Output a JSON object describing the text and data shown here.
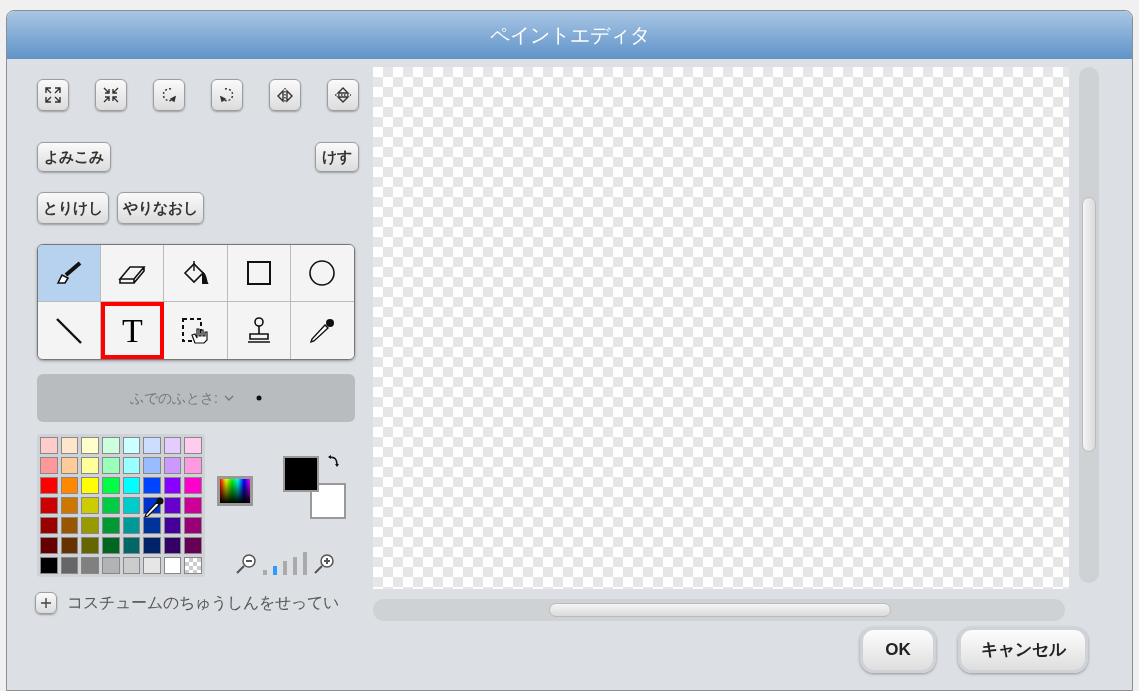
{
  "window": {
    "title": "ペイントエディタ"
  },
  "transform_buttons": [
    {
      "kind": "grow"
    },
    {
      "kind": "shrink"
    },
    {
      "kind": "rotate-left"
    },
    {
      "kind": "rotate-right"
    },
    {
      "kind": "flip-horizontal"
    },
    {
      "kind": "flip-vertical"
    }
  ],
  "file_buttons": [
    {
      "label": "よみこみ"
    },
    {
      "label": "けす"
    }
  ],
  "edit_buttons": [
    {
      "label": "とりけし"
    },
    {
      "label": "やりなおし"
    }
  ],
  "tools": [
    {
      "kind": "brush",
      "selected": true,
      "highlighted": false
    },
    {
      "kind": "eraser",
      "selected": false,
      "highlighted": false
    },
    {
      "kind": "fill",
      "selected": false,
      "highlighted": false
    },
    {
      "kind": "rectangle",
      "selected": false,
      "highlighted": false
    },
    {
      "kind": "ellipse",
      "selected": false,
      "highlighted": false
    },
    {
      "kind": "line",
      "selected": false,
      "highlighted": false
    },
    {
      "kind": "text",
      "label": "T",
      "selected": false,
      "highlighted": true
    },
    {
      "kind": "select",
      "selected": false,
      "highlighted": false
    },
    {
      "kind": "stamp",
      "selected": false,
      "highlighted": false
    },
    {
      "kind": "eyedropper",
      "selected": false,
      "highlighted": false
    }
  ],
  "brush_size": {
    "label": "ふでのふとさ:",
    "disabled": true
  },
  "palette": [
    {
      "kind": "solid",
      "color": "#ffcccc"
    },
    {
      "kind": "solid",
      "color": "#ffe5cc"
    },
    {
      "kind": "solid",
      "color": "#ffffcc"
    },
    {
      "kind": "solid",
      "color": "#ccffdd"
    },
    {
      "kind": "solid",
      "color": "#ccffff"
    },
    {
      "kind": "solid",
      "color": "#ccddff"
    },
    {
      "kind": "solid",
      "color": "#e5ccff"
    },
    {
      "kind": "solid",
      "color": "#ffccf0"
    },
    {
      "kind": "solid",
      "color": "#ff9999"
    },
    {
      "kind": "solid",
      "color": "#ffcc99"
    },
    {
      "kind": "solid",
      "color": "#ffff99"
    },
    {
      "kind": "solid",
      "color": "#99ffbb"
    },
    {
      "kind": "solid",
      "color": "#99ffff"
    },
    {
      "kind": "solid",
      "color": "#99bbff"
    },
    {
      "kind": "solid",
      "color": "#cc99ff"
    },
    {
      "kind": "solid",
      "color": "#ff99e0"
    },
    {
      "kind": "solid",
      "color": "#ff0000"
    },
    {
      "kind": "solid",
      "color": "#ff8800"
    },
    {
      "kind": "solid",
      "color": "#ffff00"
    },
    {
      "kind": "solid",
      "color": "#00ff44"
    },
    {
      "kind": "solid",
      "color": "#00ffff"
    },
    {
      "kind": "solid",
      "color": "#0044ff"
    },
    {
      "kind": "solid",
      "color": "#8800ff"
    },
    {
      "kind": "solid",
      "color": "#ff00cc"
    },
    {
      "kind": "solid",
      "color": "#cc0000"
    },
    {
      "kind": "solid",
      "color": "#cc7700"
    },
    {
      "kind": "solid",
      "color": "#cccc00"
    },
    {
      "kind": "solid",
      "color": "#00cc44"
    },
    {
      "kind": "solid",
      "color": "#00cccc"
    },
    {
      "kind": "solid",
      "color": "#0033cc"
    },
    {
      "kind": "solid",
      "color": "#6600cc"
    },
    {
      "kind": "solid",
      "color": "#cc0099"
    },
    {
      "kind": "solid",
      "color": "#990000"
    },
    {
      "kind": "solid",
      "color": "#995500"
    },
    {
      "kind": "solid",
      "color": "#999900"
    },
    {
      "kind": "solid",
      "color": "#009933"
    },
    {
      "kind": "solid",
      "color": "#009999"
    },
    {
      "kind": "solid",
      "color": "#003399"
    },
    {
      "kind": "solid",
      "color": "#440099"
    },
    {
      "kind": "solid",
      "color": "#990077"
    },
    {
      "kind": "solid",
      "color": "#660000"
    },
    {
      "kind": "solid",
      "color": "#663300"
    },
    {
      "kind": "solid",
      "color": "#666600"
    },
    {
      "kind": "solid",
      "color": "#006622"
    },
    {
      "kind": "solid",
      "color": "#006666"
    },
    {
      "kind": "solid",
      "color": "#002266"
    },
    {
      "kind": "solid",
      "color": "#330066"
    },
    {
      "kind": "solid",
      "color": "#660055"
    },
    {
      "kind": "solid",
      "color": "#000000"
    },
    {
      "kind": "solid",
      "color": "#666666"
    },
    {
      "kind": "solid",
      "color": "#808080"
    },
    {
      "kind": "solid",
      "color": "#b3b3b3"
    },
    {
      "kind": "solid",
      "color": "#cccccc"
    },
    {
      "kind": "solid",
      "color": "#e6e6e6"
    },
    {
      "kind": "solid",
      "color": "#ffffff"
    },
    {
      "kind": "transparent"
    }
  ],
  "current_colors": [
    {
      "kind": "foreground",
      "color": "#000000"
    },
    {
      "kind": "background",
      "color": "#ffffff"
    }
  ],
  "zoom_levels": [
    {
      "selected": false
    },
    {
      "selected": true
    },
    {
      "selected": false
    },
    {
      "selected": false
    },
    {
      "selected": false
    }
  ],
  "center_option": {
    "label": "コスチュームのちゅうしんをせってい"
  },
  "buttons": [
    {
      "label": "OK"
    },
    {
      "label": "キャンセル"
    }
  ]
}
